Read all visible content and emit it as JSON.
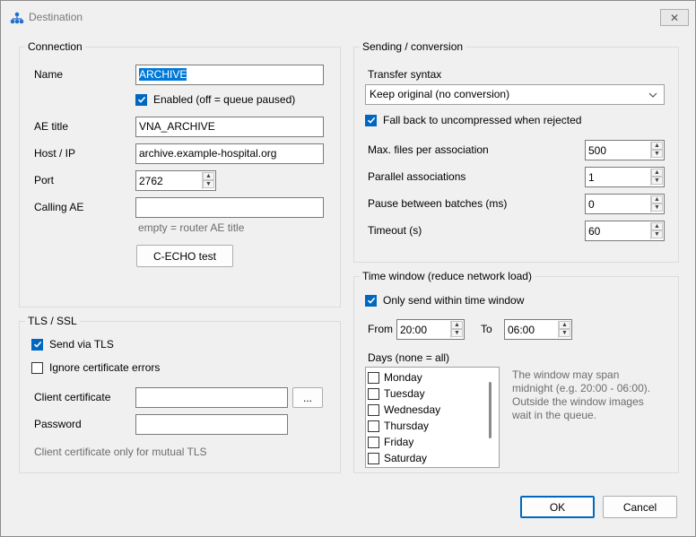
{
  "window": {
    "title": "Destination",
    "close_label": "✕",
    "icon": "network-tree-icon"
  },
  "connection": {
    "group_title": "Connection",
    "name_label": "Name",
    "name_value": "ARCHIVE",
    "enabled_label": "Enabled (off = queue paused)",
    "enabled_checked": true,
    "ae_title_label": "AE title",
    "ae_title_value": "VNA_ARCHIVE",
    "host_label": "Host / IP",
    "host_value": "archive.example-hospital.org",
    "port_label": "Port",
    "port_value": "2762",
    "calling_ae_label": "Calling AE",
    "calling_ae_value": "",
    "calling_ae_hint": "empty = router AE title",
    "cecho_button": "C-ECHO test"
  },
  "tls": {
    "group_title": "TLS / SSL",
    "send_tls_label": "Send via TLS",
    "send_tls_checked": true,
    "ignore_cert_label": "Ignore certificate errors",
    "ignore_cert_checked": false,
    "client_cert_label": "Client certificate",
    "client_cert_value": "",
    "browse_button": "...",
    "password_label": "Password",
    "password_value": "",
    "hint": "Client certificate only for mutual TLS"
  },
  "sending": {
    "group_title": "Sending / conversion",
    "syntax_label": "Transfer syntax",
    "syntax_value": "Keep original (no conversion)",
    "fallback_label": "Fall back to uncompressed when rejected",
    "fallback_checked": true,
    "max_files_label": "Max. files per association",
    "max_files_value": "500",
    "parallel_label": "Parallel associations",
    "parallel_value": "1",
    "pause_label": "Pause between batches (ms)",
    "pause_value": "0",
    "timeout_label": "Timeout (s)",
    "timeout_value": "60"
  },
  "time_window": {
    "group_title": "Time window (reduce network load)",
    "only_send_label": "Only send within time window",
    "only_send_checked": true,
    "from_label": "From",
    "from_value": "20:00",
    "to_label": "To",
    "to_value": "06:00",
    "days_label": "Days (none = all)",
    "days": [
      "Monday",
      "Tuesday",
      "Wednesday",
      "Thursday",
      "Friday",
      "Saturday"
    ],
    "note": "The window may span midnight (e.g. 20:00 - 06:00). Outside the window images wait in the queue."
  },
  "footer": {
    "ok_button": "OK",
    "cancel_button": "Cancel"
  }
}
